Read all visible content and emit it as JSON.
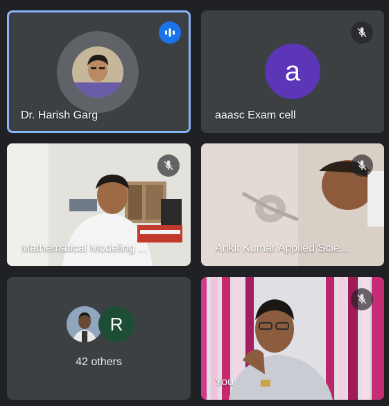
{
  "colors": {
    "background": "#202124",
    "tile": "#3c4043",
    "active_border": "#8ab4f8",
    "speaking_badge": "#1a73e8",
    "purple_avatar": "#5b36b6",
    "green_avatar": "#1e4d35"
  },
  "tiles": [
    {
      "name": "Dr. Harish Garg",
      "status_icon": "speaking-indicator-icon"
    },
    {
      "name": "aaasc Exam cell",
      "avatar_letter": "a",
      "status_icon": "mic-off-icon"
    },
    {
      "name": "Mathematical Modeling ...",
      "status_icon": "mic-off-icon"
    },
    {
      "name": "Ankit Kumar Applied Scie...",
      "status_icon": "mic-off-icon"
    },
    {
      "others_label": "42 others",
      "avatar_letter": "R"
    },
    {
      "name": "You",
      "status_icon": "mic-off-icon"
    }
  ]
}
